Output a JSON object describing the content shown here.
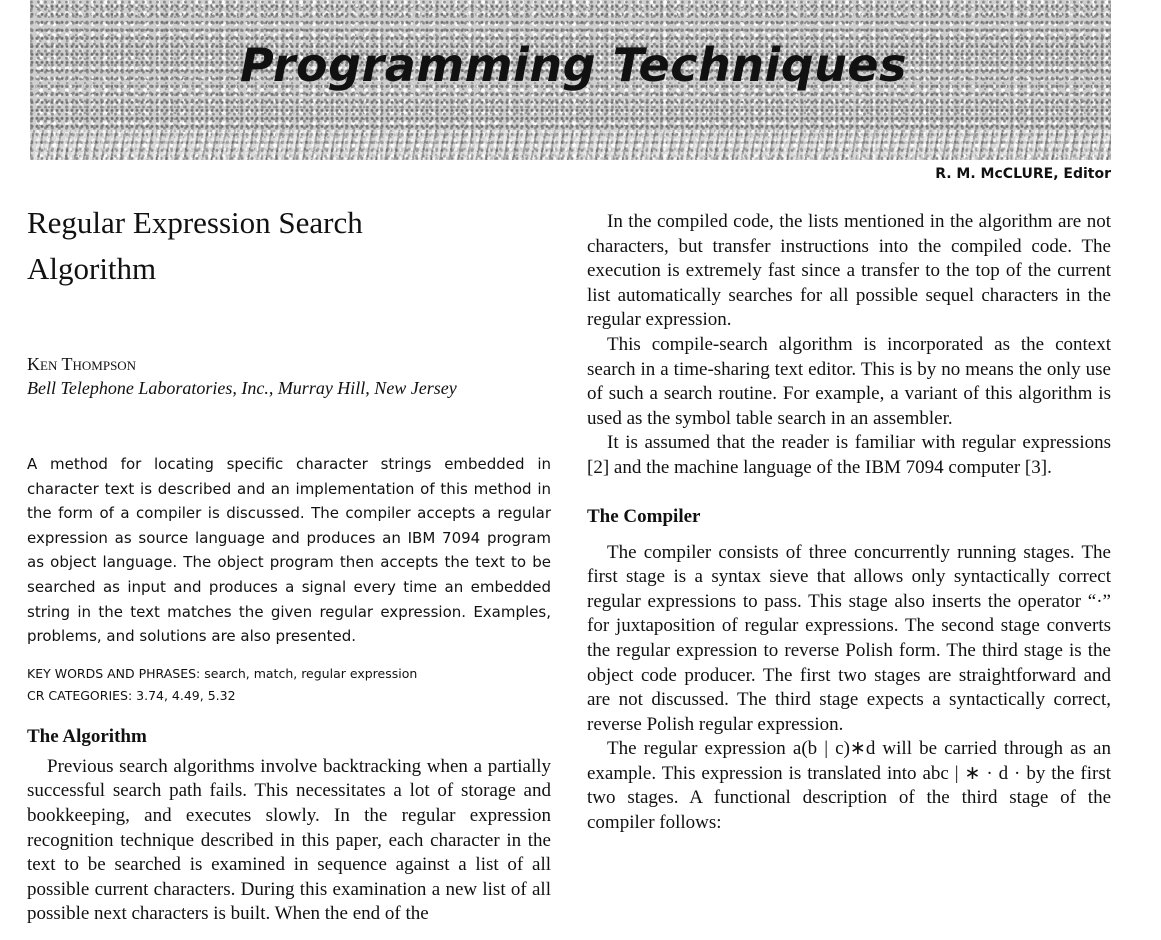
{
  "header": {
    "banner_title": "Programming Techniques",
    "editor": "R. M. McCLURE, Editor"
  },
  "article": {
    "title_line1": "Regular Expression Search",
    "title_line2": "Algorithm",
    "author": "Ken Thompson",
    "affiliation": "Bell Telephone Laboratories, Inc., Murray Hill, New Jersey",
    "abstract": "A method for locating specific character strings embedded in character text is described and an implementation of this method in the form of a compiler is discussed. The compiler accepts a regular expression as source language and produces an IBM 7094 program as object language. The object program then accepts the text to be searched as input and produces a signal every time an embedded string in the text matches the given regular expression. Examples, problems, and solutions are also presented.",
    "keywords_line": "KEY WORDS AND PHRASES:  search, match, regular expression",
    "categories_line": "CR CATEGORIES:  3.74, 4.49, 5.32"
  },
  "sections": {
    "algorithm": {
      "heading": "The Algorithm",
      "p1": "Previous search algorithms involve backtracking when a partially successful search path fails. This necessitates a lot of storage and bookkeeping, and executes slowly. In the regular expression recognition technique described in this paper, each character in the text to be searched is examined in sequence against a list of all possible current characters. During this examination a new list of all possible next characters is built. When the end of the"
    },
    "intro": {
      "p1": "In the compiled code, the lists mentioned in the algorithm are not characters, but transfer instructions into the compiled code. The execution is extremely fast since a transfer to the top of the current list automatically searches for all possible sequel characters in the regular expression.",
      "p2": "This compile-search algorithm is incorporated as the context search in a time-sharing text editor. This is by no means the only use of such a search routine. For example, a variant of this algorithm is used as the symbol table search in an assembler.",
      "p3": "It is assumed that the reader is familiar with regular expressions [2] and the machine language of the IBM 7094 computer [3]."
    },
    "compiler": {
      "heading": "The Compiler",
      "p1": "The compiler consists of three concurrently running stages. The first stage is a syntax sieve that allows only syntactically correct regular expressions to pass. This stage also inserts the operator “·” for juxtaposition of regular expressions. The second stage converts the regular expression to reverse Polish form. The third stage is the object code producer. The first two stages are straightforward and are not discussed. The third stage expects a syntactically correct, reverse Polish regular expression.",
      "p2": "The regular expression a(b | c)∗d will be carried through as an example. This expression is translated into abc | ∗ · d · by the first two stages. A functional description of the third stage of the compiler follows:"
    }
  }
}
